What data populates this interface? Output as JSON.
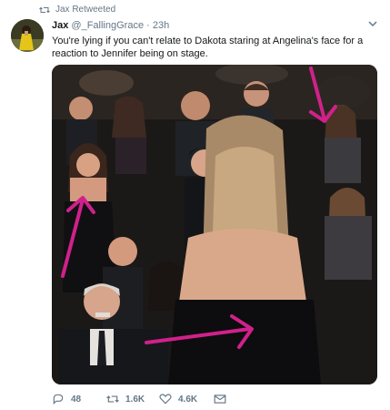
{
  "retweet_label": "Jax Retweeted",
  "tweet": {
    "name": "Jax",
    "handle": "@_FallingGrace",
    "separator": "·",
    "time": "23h",
    "text": "You're lying if you can't relate to Dakota staring at Angelina's face for a reaction to Jennifer being on stage."
  },
  "actions": {
    "reply_count": "48",
    "retweet_count": "1.6K",
    "like_count": "4.6K"
  },
  "colors": {
    "text_primary": "#14171a",
    "text_secondary": "#657786",
    "arrow_annotation": "#d0218a"
  },
  "icons": [
    "retweet-icon",
    "chevron-down-icon",
    "reply-icon",
    "retweet-icon",
    "like-icon",
    "direct-message-icon"
  ]
}
